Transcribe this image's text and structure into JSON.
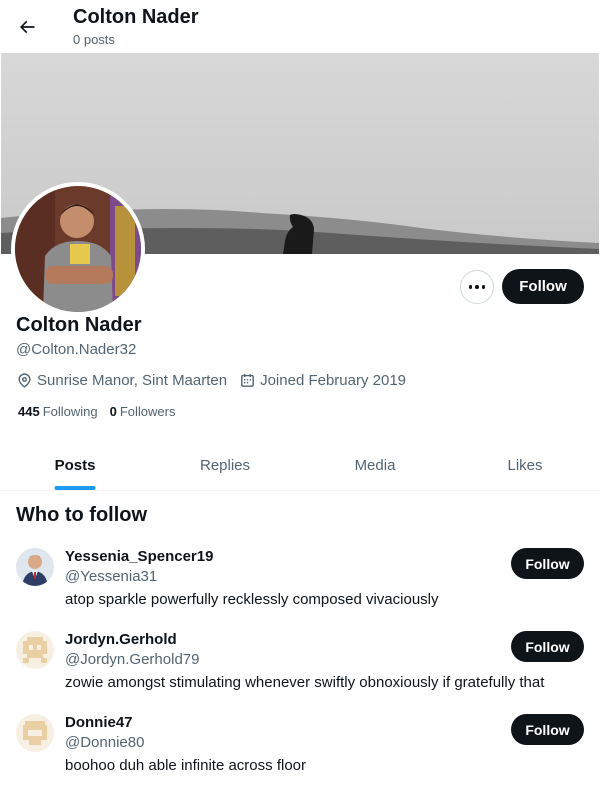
{
  "header": {
    "title": "Colton Nader",
    "subtitle": "0 posts",
    "back_icon": "arrow-left-icon"
  },
  "profile": {
    "name": "Colton Nader",
    "handle": "@Colton.Nader32",
    "location": "Sunrise Manor, Sint Maarten",
    "joined": "Joined February 2019",
    "following_count": "445",
    "following_label": "Following",
    "followers_count": "0",
    "followers_label": "Followers",
    "follow_label": "Follow",
    "more_icon": "ellipsis-icon",
    "location_icon": "location-pin-icon",
    "calendar_icon": "calendar-icon"
  },
  "tabs": [
    {
      "label": "Posts",
      "active": true
    },
    {
      "label": "Replies",
      "active": false
    },
    {
      "label": "Media",
      "active": false
    },
    {
      "label": "Likes",
      "active": false
    }
  ],
  "who_to_follow": {
    "title": "Who to follow",
    "items": [
      {
        "name": "Yessenia_Spencer19",
        "handle": "@Yessenia31",
        "bio": "atop sparkle powerfully recklessly composed vivaciously",
        "follow_label": "Follow"
      },
      {
        "name": "Jordyn.Gerhold",
        "handle": "@Jordyn.Gerhold79",
        "bio": "zowie amongst stimulating whenever swiftly obnoxiously if gratefully that",
        "follow_label": "Follow"
      },
      {
        "name": "Donnie47",
        "handle": "@Donnie80",
        "bio": "boohoo duh able infinite across floor",
        "follow_label": "Follow"
      }
    ]
  },
  "colors": {
    "accent": "#1d9bf0",
    "text_primary": "#0f1419",
    "text_secondary": "#536471",
    "button_dark": "#0f1419"
  }
}
